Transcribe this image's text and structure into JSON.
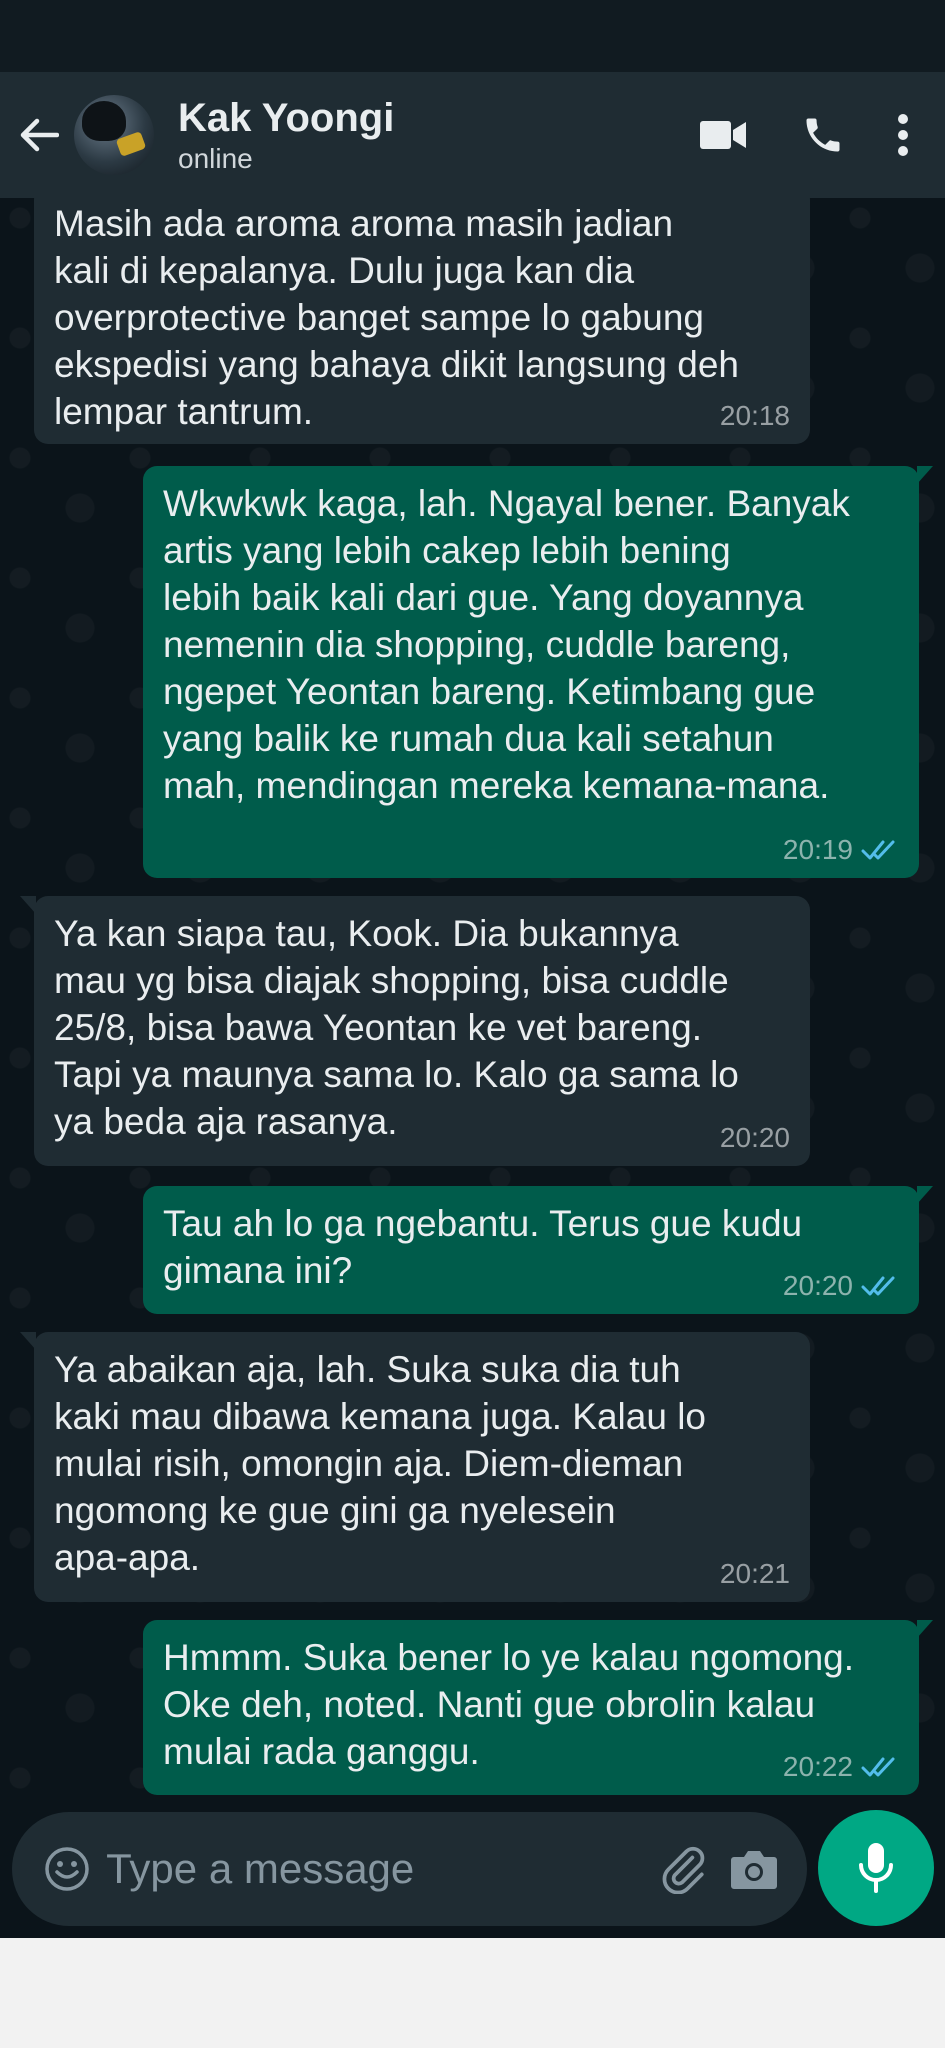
{
  "header": {
    "contact_name": "Kak Yoongi",
    "status": "online"
  },
  "messages": [
    {
      "direction": "in",
      "text": "Masih ada aroma aroma masih jadian\nkali di kepalanya. Dulu juga kan dia\noverprotective banget sampe lo gabung\nekspedisi yang bahaya dikit langsung deh\nlempar tantrum.",
      "time": "20:18"
    },
    {
      "direction": "out",
      "text": "Wkwkwk kaga, lah. Ngayal bener. Banyak\nartis yang lebih cakep lebih bening\nlebih baik kali dari gue. Yang doyannya\nnemenin dia shopping, cuddle bareng,\nngepet Yeontan bareng. Ketimbang gue\nyang balik ke rumah dua kali setahun\nmah, mendingan mereka kemana-mana.",
      "time": "20:19",
      "read": true
    },
    {
      "direction": "in",
      "text": "Ya kan siapa tau, Kook. Dia bukannya\nmau yg bisa diajak shopping, bisa cuddle\n25/8, bisa bawa Yeontan ke vet bareng.\nTapi ya maunya sama lo. Kalo ga sama lo\nya beda aja rasanya.",
      "time": "20:20"
    },
    {
      "direction": "out",
      "text": "Tau ah lo ga ngebantu. Terus gue kudu\ngimana ini?",
      "time": "20:20",
      "read": true
    },
    {
      "direction": "in",
      "text": "Ya abaikan aja, lah. Suka suka dia tuh\nkaki mau dibawa kemana juga. Kalau lo\nmulai risih, omongin aja. Diem-dieman\nngomong ke gue gini ga nyelesein\napa-apa.",
      "time": "20:21"
    },
    {
      "direction": "out",
      "text": "Hmmm. Suka bener lo ye kalau ngomong.\nOke deh, noted. Nanti gue obrolin kalau\nmulai rada ganggu.",
      "time": "20:22",
      "read": true
    }
  ],
  "composer": {
    "placeholder": "Type a message"
  },
  "colors": {
    "header_bg": "#1f2c33",
    "chat_bg": "#0b141a",
    "incoming_bubble": "#1f2c33",
    "outgoing_bubble": "#005c4b",
    "read_ticks": "#53bdeb",
    "mic_button": "#00a884"
  },
  "icons": {
    "back": "arrow-left-icon",
    "video": "video-camera-icon",
    "call": "phone-icon",
    "more": "more-vertical-icon",
    "emoji": "emoji-icon",
    "attach": "paperclip-icon",
    "camera": "camera-icon",
    "mic": "microphone-icon"
  }
}
